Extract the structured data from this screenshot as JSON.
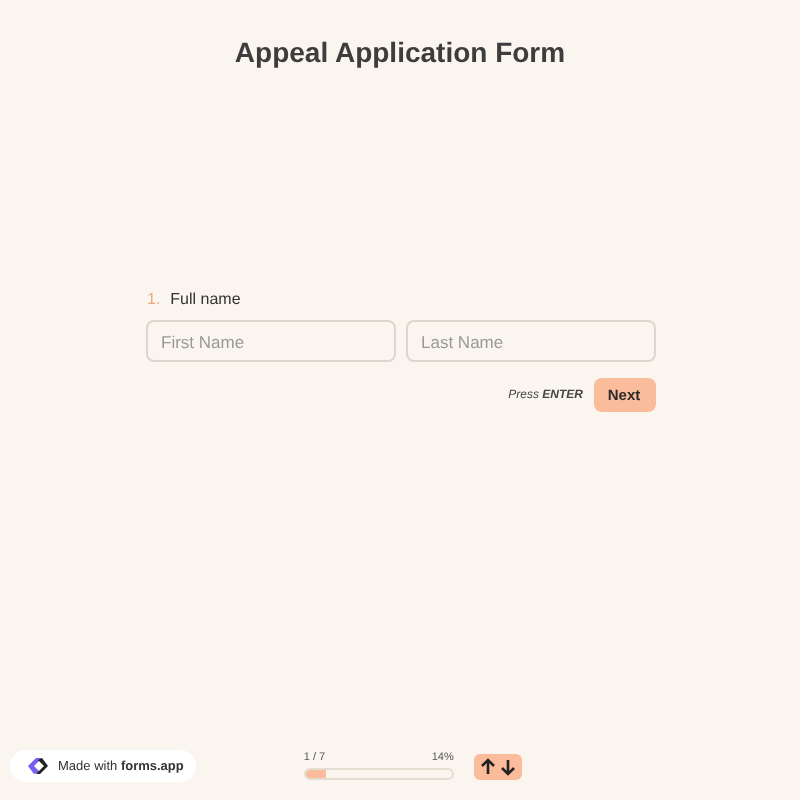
{
  "title": "Appeal Application Form",
  "question": {
    "number": "1.",
    "label": "Full name",
    "fields": [
      {
        "placeholder": "First Name"
      },
      {
        "placeholder": "Last Name"
      }
    ]
  },
  "hint": "Press **ENTER**",
  "next_button": "Next",
  "badge": {
    "prefix": "Made with ",
    "brand": "forms.app"
  },
  "progress": {
    "count": "1 / 7",
    "percent": "14%",
    "level": 0.14
  }
}
